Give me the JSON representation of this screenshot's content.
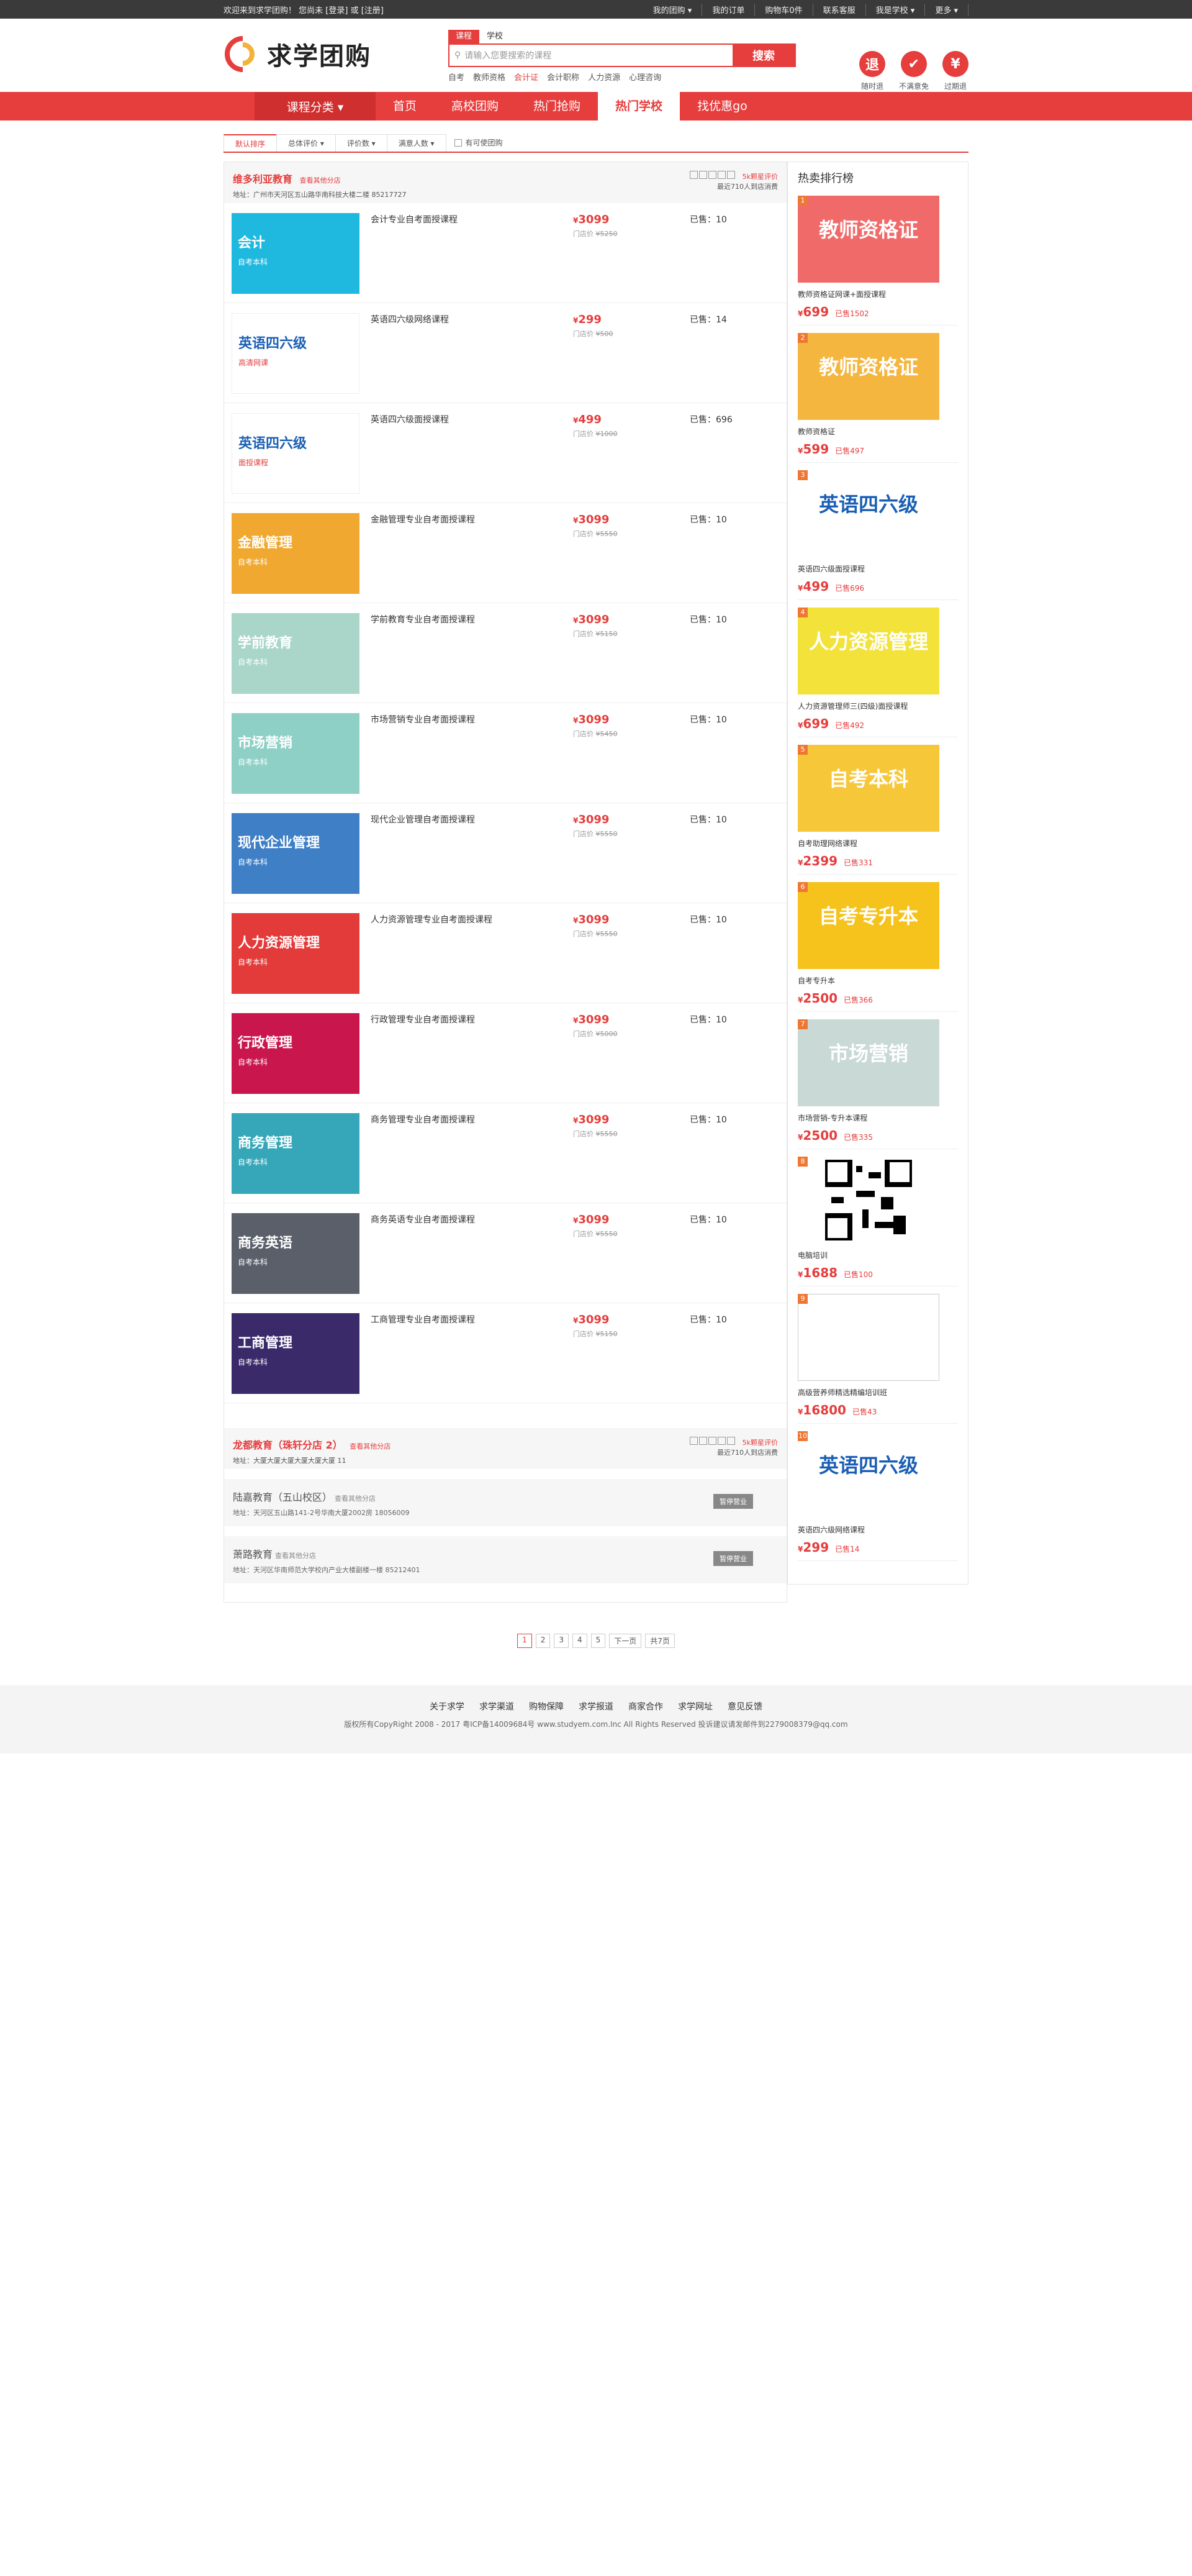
{
  "topbar": {
    "welcome": "欢迎来到求学团购！",
    "login_text": "您尚未 [登录] 或 [注册]",
    "links": [
      "我的团购 ▾",
      "我的订单",
      "购物车0件",
      "联系客服",
      "我是学校 ▾",
      "更多 ▾"
    ]
  },
  "header": {
    "logo_text": "求学团购",
    "search_tabs": [
      "课程",
      "学校"
    ],
    "search_placeholder": "请输入您要搜索的课程",
    "search_button": "搜索",
    "hot_words": [
      "自考",
      "教师资格",
      "会计证",
      "会计职称",
      "人力资源",
      "心理咨询"
    ],
    "promises": [
      {
        "icon": "退",
        "label": "随时退"
      },
      {
        "icon": "✔",
        "label": "不满意免"
      },
      {
        "icon": "¥",
        "label": "过期退"
      }
    ]
  },
  "nav": {
    "category": "课程分类 ▾",
    "items": [
      "首页",
      "高校团购",
      "热门抢购",
      "热门学校",
      "找优惠go"
    ]
  },
  "sort": {
    "items": [
      "默认排序",
      "总体评价 ▾",
      "评价数 ▾",
      "满意人数 ▾"
    ],
    "checkbox_label": "有可使团购"
  },
  "stores": [
    {
      "name": "维多利亚教育",
      "tag": "查看其他分店",
      "address": "地址：广州市天河区五山路华南科技大楼二楼 85217727",
      "rate_link": "5k颗星评价",
      "rate_count": "最近710人到店消费",
      "courses": [
        {
          "title": "会计专业自考面授课程",
          "price": "3099",
          "orig": "¥5250",
          "sold": "已售：10",
          "img_main": "会计",
          "img_sub": "自考本科",
          "color": "#1fb9e0"
        },
        {
          "title": "英语四六级网络课程",
          "price": "299",
          "orig": "¥500",
          "sold": "已售：14",
          "img_main": "英语四六级",
          "img_sub": "高清网课",
          "color": "#ffffff"
        },
        {
          "title": "英语四六级面授课程",
          "price": "499",
          "orig": "¥1000",
          "sold": "已售：696",
          "img_main": "英语四六级",
          "img_sub": "面授课程",
          "color": "#ffffff"
        },
        {
          "title": "金融管理专业自考面授课程",
          "price": "3099",
          "orig": "¥5550",
          "sold": "已售：10",
          "img_main": "金融管理",
          "img_sub": "自考本科",
          "color": "#f0a830"
        },
        {
          "title": "学前教育专业自考面授课程",
          "price": "3099",
          "orig": "¥5150",
          "sold": "已售：10",
          "img_main": "学前教育",
          "img_sub": "自考本科",
          "color": "#a9d6c8"
        },
        {
          "title": "市场营销专业自考面授课程",
          "price": "3099",
          "orig": "¥5450",
          "sold": "已售：10",
          "img_main": "市场营销",
          "img_sub": "自考本科",
          "color": "#8fd0c6"
        },
        {
          "title": "现代企业管理自考面授课程",
          "price": "3099",
          "orig": "¥5550",
          "sold": "已售：10",
          "img_main": "现代企业管理",
          "img_sub": "自考本科",
          "color": "#3f7fc6"
        },
        {
          "title": "人力资源管理专业自考面授课程",
          "price": "3099",
          "orig": "¥5550",
          "sold": "已售：10",
          "img_main": "人力资源管理",
          "img_sub": "自考本科",
          "color": "#e33a3a"
        },
        {
          "title": "行政管理专业自考面授课程",
          "price": "3099",
          "orig": "¥5000",
          "sold": "已售：10",
          "img_main": "行政管理",
          "img_sub": "自考本科",
          "color": "#c9174e"
        },
        {
          "title": "商务管理专业自考面授课程",
          "price": "3099",
          "orig": "¥5550",
          "sold": "已售：10",
          "img_main": "商务管理",
          "img_sub": "自考本科",
          "color": "#35a7b8"
        },
        {
          "title": "商务英语专业自考面授课程",
          "price": "3099",
          "orig": "¥5550",
          "sold": "已售：10",
          "img_main": "商务英语",
          "img_sub": "自考本科",
          "color": "#5a5f6a"
        },
        {
          "title": "工商管理专业自考面授课程",
          "price": "3099",
          "orig": "¥5150",
          "sold": "已售：10",
          "img_main": "工商管理",
          "img_sub": "自考本科",
          "color": "#3a2a6a"
        }
      ]
    }
  ],
  "store2": {
    "name": "龙都教育（珠轩分店 2）",
    "tag": "查看其他分店",
    "address": "地址：大厦大厦大厦大厦大厦大厦 11",
    "rate_link": "5k颗星评价",
    "rate_count": "最近710人到店消费"
  },
  "gray_stores": [
    {
      "name": "陆嘉教育（五山校区）",
      "tag": "查看其他分店",
      "address": "地址：天河区五山路141-2号华南大厦2002房 18056009",
      "btn": "暂停营业"
    },
    {
      "name": "萧路教育",
      "tag": "查看其他分店",
      "address": "地址：天河区华南师范大学校内产业大楼副楼一楼 85212401",
      "btn": "暂停营业"
    }
  ],
  "rank": {
    "title": "热卖排行榜",
    "items": [
      {
        "num": "1",
        "big": "教师资格证",
        "name": "教师资格证网课+面授课程",
        "price": "699",
        "sold": "已售1502",
        "color": "#f06a6a"
      },
      {
        "num": "2",
        "big": "教师资格证",
        "name": "教师资格证",
        "price": "599",
        "sold": "已售497",
        "color": "#f4b63f"
      },
      {
        "num": "3",
        "big": "英语四六级",
        "name": "英语四六级面授课程",
        "price": "499",
        "sold": "已售696",
        "color": "#ffffff"
      },
      {
        "num": "4",
        "big": "人力资源管理",
        "name": "人力资源管理师三(四级)面授课程",
        "price": "699",
        "sold": "已售492",
        "color": "#f2e23a"
      },
      {
        "num": "5",
        "big": "自考本科",
        "name": "自考助理网络课程",
        "price": "2399",
        "sold": "已售331",
        "color": "#f7c73a"
      },
      {
        "num": "6",
        "big": "自考专升本",
        "name": "自考专升本",
        "price": "2500",
        "sold": "已售366",
        "color": "#f6c21c"
      },
      {
        "num": "7",
        "big": "市场营销",
        "name": "市场营销-专升本课程",
        "price": "2500",
        "sold": "已售335",
        "color": "#c9d9d6"
      },
      {
        "num": "8",
        "big": "",
        "name": "电脑培训",
        "price": "1688",
        "sold": "已售100",
        "color": "#ffffff"
      },
      {
        "num": "9",
        "big": "",
        "name": "高级营养师精选精编培训班",
        "price": "16800",
        "sold": "已售43",
        "color": "#ffffff"
      },
      {
        "num": "10",
        "big": "英语四六级",
        "name": "英语四六级网络课程",
        "price": "299",
        "sold": "已售14",
        "color": "#ffffff"
      }
    ]
  },
  "pager": {
    "pages": [
      "1",
      "2",
      "3",
      "4",
      "5"
    ],
    "next": "下一页",
    "total": "共7页"
  },
  "footer": {
    "links": [
      "关于求学",
      "求学渠道",
      "购物保障",
      "求学报道",
      "商家合作",
      "求学网址",
      "意见反馈"
    ],
    "copyright": "版权所有CopyRight 2008 - 2017 粤ICP备14009684号 www.studyem.com.Inc All Rights Reserved 投诉建议请发邮件到2279008379@qq.com"
  }
}
